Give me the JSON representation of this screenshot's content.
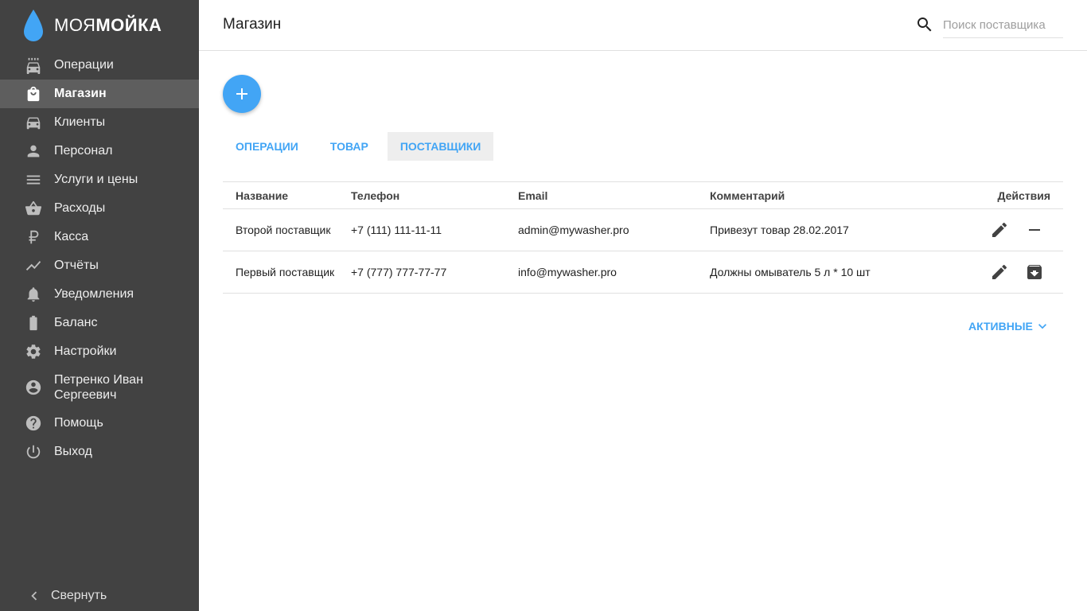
{
  "brand": {
    "name_light": "МОЯ",
    "name_bold": "МОЙКА",
    "color": "#42a5f5"
  },
  "sidebar": {
    "items": [
      {
        "label": "Операции",
        "icon": "car-wash-icon"
      },
      {
        "label": "Магазин",
        "icon": "shopping-bag-icon",
        "active": true
      },
      {
        "label": "Клиенты",
        "icon": "car-icon"
      },
      {
        "label": "Персонал",
        "icon": "person-icon"
      },
      {
        "label": "Услуги и цены",
        "icon": "list-icon"
      },
      {
        "label": "Расходы",
        "icon": "basket-icon"
      },
      {
        "label": "Касса",
        "icon": "ruble-icon"
      },
      {
        "label": "Отчёты",
        "icon": "trending-icon"
      },
      {
        "label": "Уведомления",
        "icon": "bell-icon"
      },
      {
        "label": "Баланс",
        "icon": "battery-icon"
      },
      {
        "label": "Настройки",
        "icon": "gear-icon"
      },
      {
        "label": "Петренко Иван Сергеевич",
        "icon": "account-circle-icon"
      },
      {
        "label": "Помощь",
        "icon": "help-icon"
      },
      {
        "label": "Выход",
        "icon": "power-icon"
      }
    ],
    "collapse_label": "Свернуть"
  },
  "header": {
    "title": "Магазин",
    "search_placeholder": "Поиск поставщика"
  },
  "tabs": [
    {
      "label": "ОПЕРАЦИИ"
    },
    {
      "label": "ТОВАР"
    },
    {
      "label": "ПОСТАВЩИКИ",
      "active": true
    }
  ],
  "table": {
    "columns": [
      "Название",
      "Телефон",
      "Email",
      "Комментарий",
      "Действия"
    ],
    "rows": [
      {
        "name": "Второй поставщик",
        "phone": "+7 (111) 111-11-11",
        "email": "admin@mywasher.pro",
        "comment": "Привезут товар 28.02.2017",
        "actions": [
          "edit-icon",
          "remove-icon"
        ]
      },
      {
        "name": "Первый поставщик",
        "phone": "+7 (777) 777-77-77",
        "email": "info@mywasher.pro",
        "comment": "Должны омыватель 5 л * 10 шт",
        "actions": [
          "edit-icon",
          "archive-icon"
        ]
      }
    ]
  },
  "filter": {
    "label": "АКТИВНЫЕ"
  }
}
